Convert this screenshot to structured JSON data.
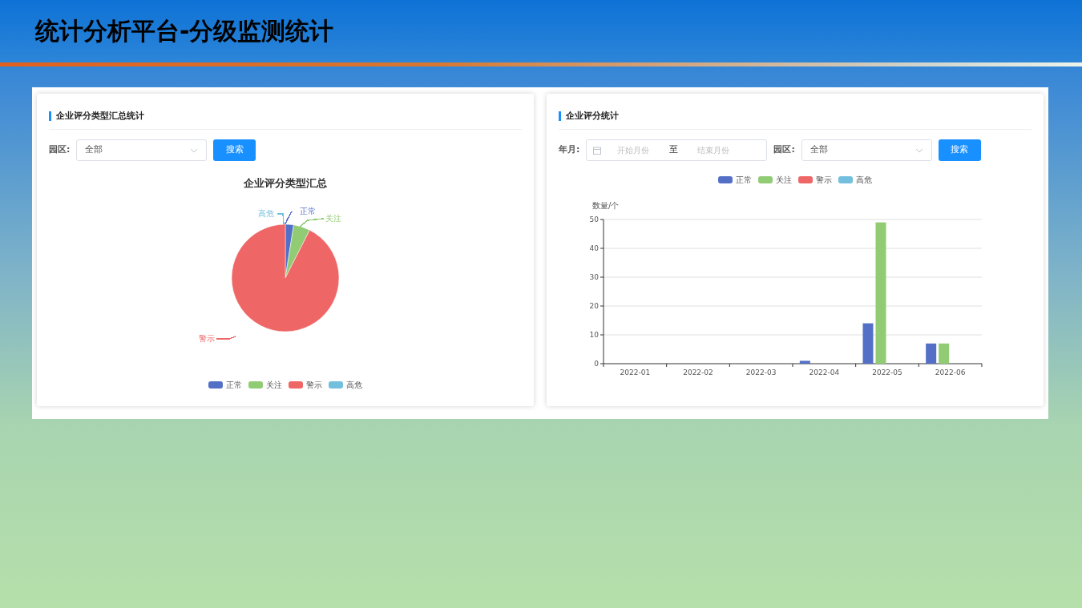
{
  "slide_title": "统计分析平台-分级监测统计",
  "panels": [
    {
      "title": "企业评分类型汇总统计",
      "filters": [
        {
          "kind": "select",
          "label": "园区:",
          "value": "全部"
        }
      ],
      "button": "搜索",
      "pie": {
        "title": "企业评分类型汇总",
        "slices": [
          {
            "name": "正常",
            "color": "#5470c6"
          },
          {
            "name": "关注",
            "color": "#91cc75"
          },
          {
            "name": "警示",
            "color": "#ee6666"
          },
          {
            "name": "高危",
            "color": "#73c0de"
          }
        ],
        "legend": [
          {
            "name": "正常",
            "color": "#5470c6"
          },
          {
            "name": "关注",
            "color": "#91cc75"
          },
          {
            "name": "警示",
            "color": "#ee6666"
          },
          {
            "name": "高危",
            "color": "#73c0de"
          }
        ]
      }
    },
    {
      "title": "企业评分统计",
      "filters": [
        {
          "kind": "range",
          "label": "年月:",
          "start_placeholder": "开始月份",
          "separator": "至",
          "end_placeholder": "结束月份"
        },
        {
          "kind": "select",
          "label": "园区:",
          "value": "全部"
        }
      ],
      "button": "搜索",
      "chart_data": {
        "type": "bar",
        "ylabel": "数量/个",
        "categories": [
          "2022-01",
          "2022-02",
          "2022-03",
          "2022-04",
          "2022-05",
          "2022-06"
        ],
        "ylim": [
          0,
          50
        ],
        "grid": true,
        "yticks": [
          0,
          10,
          20,
          30,
          40,
          50
        ],
        "series": [
          {
            "name": "正常",
            "color": "#5470c6",
            "values": [
              0,
              0,
              0,
              1,
              14,
              7
            ]
          },
          {
            "name": "关注",
            "color": "#91cc75",
            "values": [
              0,
              0,
              0,
              0,
              49,
              7
            ]
          },
          {
            "name": "警示",
            "color": "#ee6666",
            "values": [
              0,
              0,
              0,
              0,
              0,
              0
            ]
          },
          {
            "name": "高危",
            "color": "#73c0de",
            "values": [
              0,
              0,
              0,
              0,
              0,
              0
            ]
          }
        ]
      }
    }
  ]
}
